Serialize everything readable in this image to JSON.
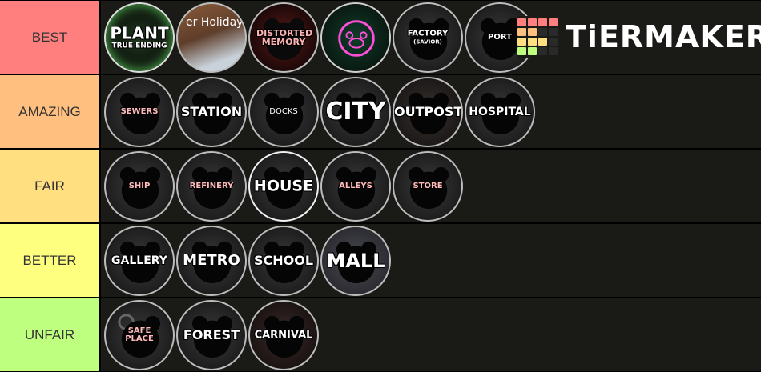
{
  "app": {
    "brand": "TiERMAKER"
  },
  "colors": {
    "best": "#ff7f7f",
    "amazing": "#ffbf7f",
    "fair": "#ffdf7f",
    "better": "#ffff7f",
    "unfair": "#bfff7f",
    "row_bg": "#1a1a17"
  },
  "tiers": [
    {
      "label": "BEST",
      "items": [
        {
          "name": "PLANT",
          "sub": "TRUE ENDING"
        },
        {
          "name": "er Holiday",
          "sub": ""
        },
        {
          "name": "DISTORTED MEMORY",
          "sub": ""
        },
        {
          "name": "",
          "sub": ""
        },
        {
          "name": "FACTORY",
          "sub": "(SAVIOR)"
        },
        {
          "name": "PORT",
          "sub": ""
        }
      ]
    },
    {
      "label": "AMAZING",
      "items": [
        {
          "name": "SEWERS",
          "sub": ""
        },
        {
          "name": "STATION",
          "sub": ""
        },
        {
          "name": "DOCKS",
          "sub": ""
        },
        {
          "name": "CITY",
          "sub": ""
        },
        {
          "name": "OUTPOST",
          "sub": ""
        },
        {
          "name": "HOSPITAL",
          "sub": ""
        }
      ]
    },
    {
      "label": "FAIR",
      "items": [
        {
          "name": "SHIP",
          "sub": ""
        },
        {
          "name": "REFINERY",
          "sub": ""
        },
        {
          "name": "HOUSE",
          "sub": ""
        },
        {
          "name": "ALLEYS",
          "sub": ""
        },
        {
          "name": "STORE",
          "sub": ""
        }
      ]
    },
    {
      "label": "BETTER",
      "items": [
        {
          "name": "GALLERY",
          "sub": ""
        },
        {
          "name": "METRO",
          "sub": ""
        },
        {
          "name": "SCHOOL",
          "sub": ""
        },
        {
          "name": "MALL",
          "sub": ""
        }
      ]
    },
    {
      "label": "UNFAIR",
      "items": [
        {
          "name": "SAFE PLACE",
          "sub": ""
        },
        {
          "name": "FOREST",
          "sub": ""
        },
        {
          "name": "CARNIVAL",
          "sub": ""
        }
      ]
    }
  ],
  "icons": {
    "logo": "tiermaker-grid-icon",
    "tile_silhouette": "bear-head-icon"
  }
}
